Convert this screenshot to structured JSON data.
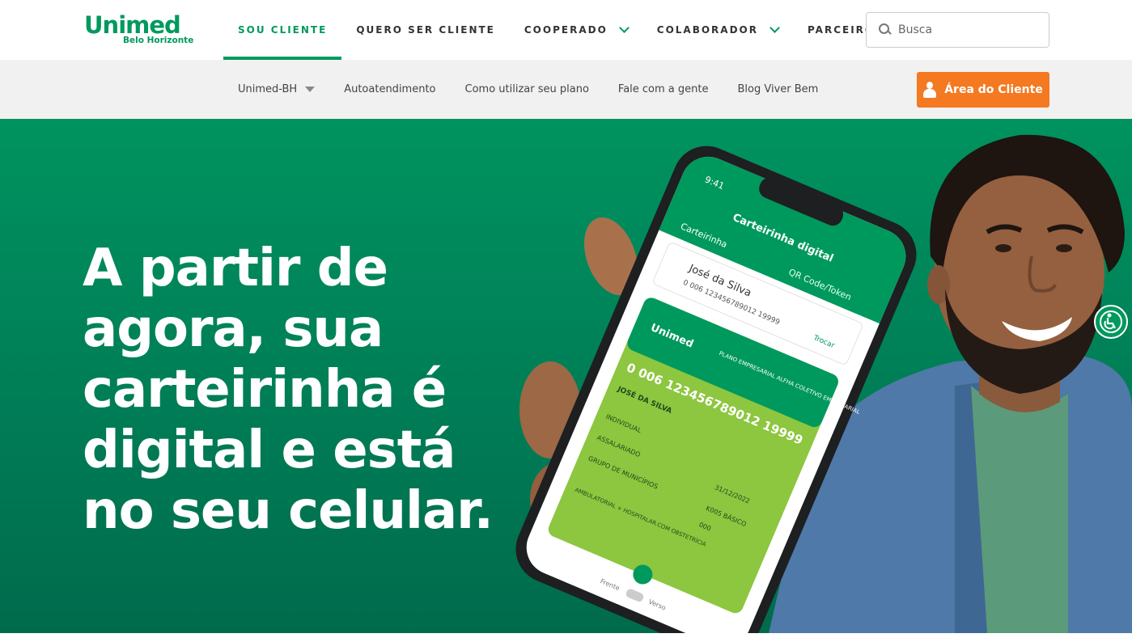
{
  "brand": {
    "name": "Unimed",
    "sub": "Belo Horizonte",
    "color": "#00995d"
  },
  "main_nav": [
    {
      "label": "SOU CLIENTE",
      "active": true,
      "dropdown": false
    },
    {
      "label": "QUERO SER CLIENTE",
      "active": false,
      "dropdown": false
    },
    {
      "label": "COOPERADO",
      "active": false,
      "dropdown": true
    },
    {
      "label": "COLABORADOR",
      "active": false,
      "dropdown": true
    },
    {
      "label": "PARCEIROS",
      "active": false,
      "dropdown": true
    }
  ],
  "search": {
    "placeholder": "Busca",
    "icon": "search-icon"
  },
  "sub_nav": [
    {
      "label": "Unimed-BH",
      "dropdown": true
    },
    {
      "label": "Autoatendimento"
    },
    {
      "label": "Como utilizar seu plano"
    },
    {
      "label": "Fale com a gente"
    },
    {
      "label": "Blog Viver Bem"
    }
  ],
  "client_area_button": {
    "label": "Área do Cliente",
    "icon": "user-icon",
    "color": "#f47920"
  },
  "hero": {
    "headline": "A partir de agora, sua carteirinha é digital e está no seu celular.",
    "background": "#00935f"
  },
  "phone_screen": {
    "time": "9:41",
    "title": "Carteirinha digital",
    "tabs": [
      "Carteirinha",
      "QR Code/Token"
    ],
    "name": "José da Silva",
    "number": "0 006 123456789012 19999",
    "swap": "Trocar",
    "card_brand": "Unimed",
    "card_plan": "PLANO EMPRESARIAL ALFHA COLETIVO EMPRESARIAL",
    "card_number": "0 006 123456789012 19999",
    "card_name": "JOSÉ DA SILVA",
    "card_fields": [
      "INDIVIDUAL",
      "ASSALARIADO",
      "GRUPO DE MUNICÍPIOS",
      "AMBULATORIAL + HOSPITALAR.COM OBSTETRÍCIA"
    ],
    "card_right": [
      "31/12/2022",
      "K005 BÁSICO",
      "000"
    ],
    "footer": [
      "Frente",
      "Verso"
    ]
  },
  "accessibility": {
    "icon": "accessibility-icon"
  }
}
